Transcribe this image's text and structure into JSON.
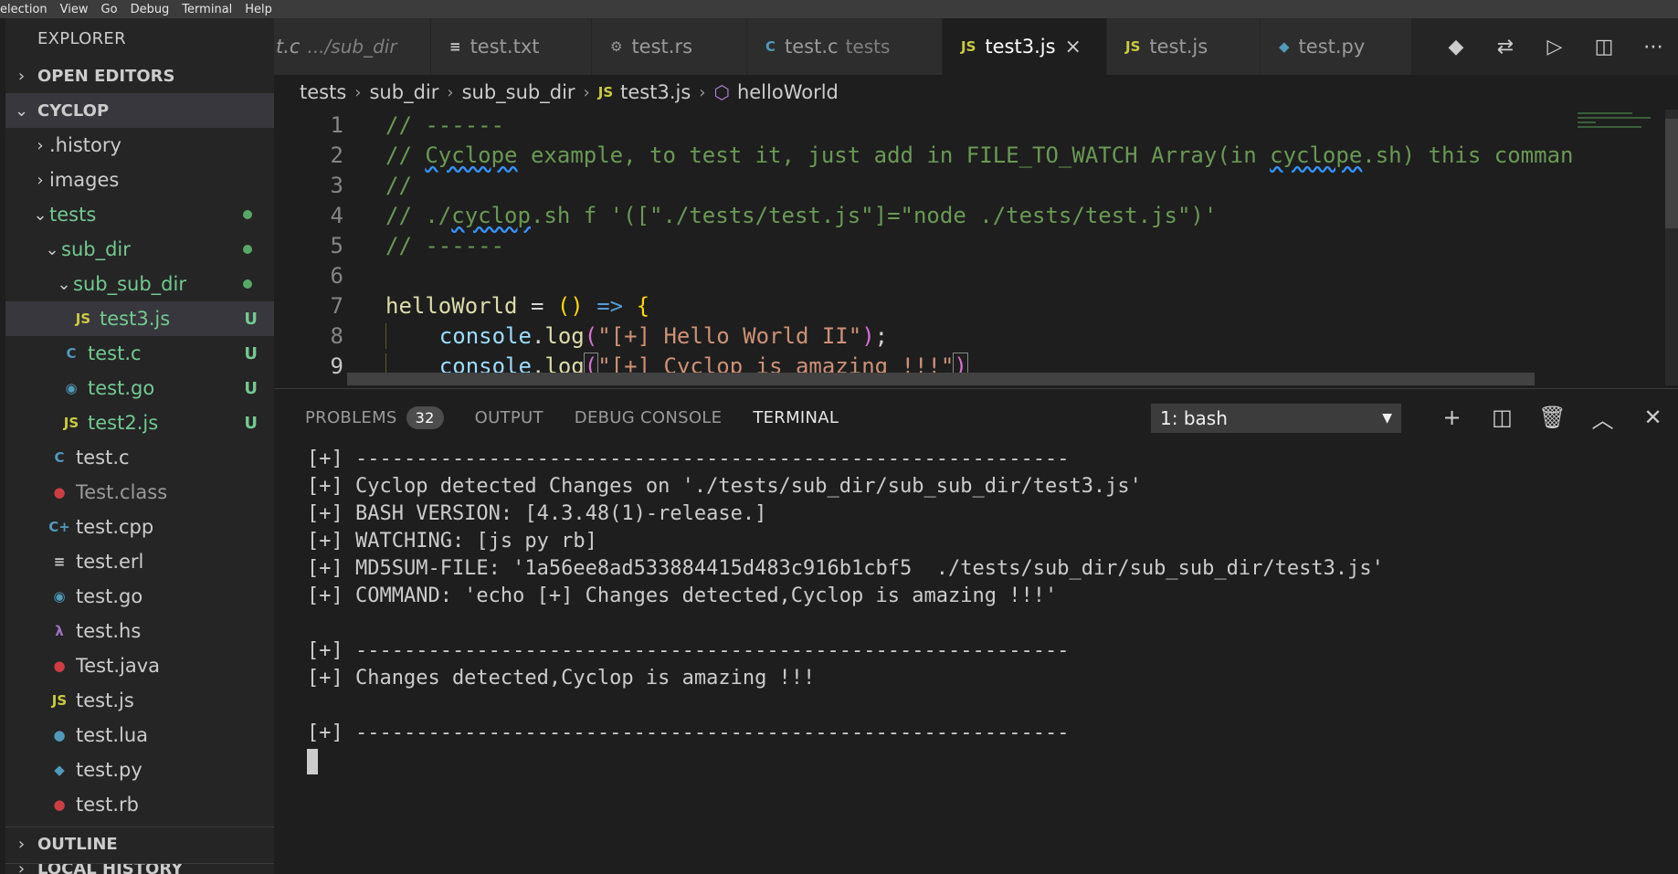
{
  "menu": [
    "election",
    "View",
    "Go",
    "Debug",
    "Terminal",
    "Help"
  ],
  "sidebar": {
    "title": "EXPLORER",
    "open_editors": "OPEN EDITORS",
    "root": "CYCLOP",
    "outline": "OUTLINE",
    "local_history": "LOCAL HISTORY",
    "items": [
      {
        "label": ".history",
        "indent": 0,
        "chev": "›",
        "icon": "",
        "icon_color": "",
        "status": "",
        "dot": false,
        "color": "#cccccc"
      },
      {
        "label": "images",
        "indent": 0,
        "chev": "›",
        "icon": "",
        "icon_color": "",
        "status": "",
        "dot": false,
        "color": "#cccccc"
      },
      {
        "label": "tests",
        "indent": 0,
        "chev": "⌄",
        "icon": "",
        "icon_color": "",
        "status": "",
        "dot": true,
        "color": "#73c991"
      },
      {
        "label": "sub_dir",
        "indent": 1,
        "chev": "⌄",
        "icon": "",
        "icon_color": "",
        "status": "",
        "dot": true,
        "color": "#73c991"
      },
      {
        "label": "sub_sub_dir",
        "indent": 2,
        "chev": "⌄",
        "icon": "",
        "icon_color": "",
        "status": "",
        "dot": true,
        "color": "#73c991"
      },
      {
        "label": "test3.js",
        "indent": 3,
        "chev": "",
        "icon": "JS",
        "icon_color": "#cbcb41",
        "status": "U",
        "dot": false,
        "color": "#73c991",
        "selected": true
      },
      {
        "label": "test.c",
        "indent": 2,
        "chev": "",
        "icon": "C",
        "icon_color": "#519aba",
        "status": "U",
        "dot": false,
        "color": "#73c991"
      },
      {
        "label": "test.go",
        "indent": 2,
        "chev": "",
        "icon": "◉",
        "icon_color": "#519aba",
        "status": "U",
        "dot": false,
        "color": "#73c991"
      },
      {
        "label": "test2.js",
        "indent": 2,
        "chev": "",
        "icon": "JS",
        "icon_color": "#cbcb41",
        "status": "U",
        "dot": false,
        "color": "#73c991"
      },
      {
        "label": "test.c",
        "indent": 1,
        "chev": "",
        "icon": "C",
        "icon_color": "#519aba",
        "status": "",
        "dot": false,
        "color": "#cccccc"
      },
      {
        "label": "Test.class",
        "indent": 1,
        "chev": "",
        "icon": "●",
        "icon_color": "#cc3e44",
        "status": "",
        "dot": false,
        "color": "#9a9a9a"
      },
      {
        "label": "test.cpp",
        "indent": 1,
        "chev": "",
        "icon": "C+",
        "icon_color": "#519aba",
        "status": "",
        "dot": false,
        "color": "#cccccc"
      },
      {
        "label": "test.erl",
        "indent": 1,
        "chev": "",
        "icon": "≡",
        "icon_color": "#cccccc",
        "status": "",
        "dot": false,
        "color": "#cccccc"
      },
      {
        "label": "test.go",
        "indent": 1,
        "chev": "",
        "icon": "◉",
        "icon_color": "#519aba",
        "status": "",
        "dot": false,
        "color": "#cccccc"
      },
      {
        "label": "test.hs",
        "indent": 1,
        "chev": "",
        "icon": "λ",
        "icon_color": "#a074c4",
        "status": "",
        "dot": false,
        "color": "#cccccc"
      },
      {
        "label": "Test.java",
        "indent": 1,
        "chev": "",
        "icon": "●",
        "icon_color": "#cc3e44",
        "status": "",
        "dot": false,
        "color": "#cccccc"
      },
      {
        "label": "test.js",
        "indent": 1,
        "chev": "",
        "icon": "JS",
        "icon_color": "#cbcb41",
        "status": "",
        "dot": false,
        "color": "#cccccc"
      },
      {
        "label": "test.lua",
        "indent": 1,
        "chev": "",
        "icon": "●",
        "icon_color": "#519aba",
        "status": "",
        "dot": false,
        "color": "#cccccc"
      },
      {
        "label": "test.py",
        "indent": 1,
        "chev": "",
        "icon": "◆",
        "icon_color": "#519aba",
        "status": "",
        "dot": false,
        "color": "#cccccc"
      },
      {
        "label": "test.rb",
        "indent": 1,
        "chev": "",
        "icon": "●",
        "icon_color": "#cc3e44",
        "status": "",
        "dot": false,
        "color": "#cccccc"
      }
    ]
  },
  "tabs": [
    {
      "label": "t.c",
      "desc": ".../sub_dir",
      "icon": "",
      "icon_color": "",
      "active": false,
      "width": 172
    },
    {
      "label": "test.txt",
      "desc": "",
      "icon": "≡",
      "icon_color": "#cccccc",
      "active": false,
      "width": 176
    },
    {
      "label": "test.rs",
      "desc": "",
      "icon": "⚙",
      "icon_color": "#9a9a9a",
      "active": false,
      "width": 170
    },
    {
      "label": "test.c",
      "desc": "tests",
      "icon": "C",
      "icon_color": "#519aba",
      "active": false,
      "width": 214
    },
    {
      "label": "test3.js",
      "desc": "",
      "icon": "JS",
      "icon_color": "#cbcb41",
      "active": true,
      "close": "×",
      "width": 180
    },
    {
      "label": "test.js",
      "desc": "",
      "icon": "JS",
      "icon_color": "#cbcb41",
      "active": false,
      "width": 168
    },
    {
      "label": "test.py",
      "desc": "",
      "icon": "◆",
      "icon_color": "#519aba",
      "active": false,
      "width": 166
    }
  ],
  "tab_actions": [
    "git-icon",
    "compare-icon",
    "run-icon",
    "split-icon",
    "more-icon"
  ],
  "breadcrumb": {
    "parts": [
      "tests",
      "sub_dir",
      "sub_sub_dir"
    ],
    "file_icon": "JS",
    "file": "test3.js",
    "symbol": "helloWorld"
  },
  "editor": {
    "line_numbers": [
      "1",
      "2",
      "3",
      "4",
      "5",
      "6",
      "7",
      "8",
      "9"
    ],
    "current_line": "9"
  },
  "panel": {
    "tabs": [
      {
        "label": "PROBLEMS",
        "badge": "32",
        "active": false
      },
      {
        "label": "OUTPUT",
        "badge": "",
        "active": false
      },
      {
        "label": "DEBUG CONSOLE",
        "badge": "",
        "active": false
      },
      {
        "label": "TERMINAL",
        "badge": "",
        "active": true
      }
    ],
    "terminal_select": "1: bash",
    "terminal_lines": [
      "[+] -----------------------------------------------------------",
      "[+] Cyclop detected Changes on './tests/sub_dir/sub_sub_dir/test3.js'",
      "[+] BASH VERSION: [4.3.48(1)-release.]",
      "[+] WATCHING: [js py rb]",
      "[+] MD5SUM-FILE: '1a56ee8ad533884415d483c916b1cbf5  ./tests/sub_dir/sub_sub_dir/test3.js'",
      "[+] COMMAND: 'echo [+] Changes detected,Cyclop is amazing !!!'",
      "",
      "[+] -----------------------------------------------------------",
      "[+] Changes detected,Cyclop is amazing !!!",
      "",
      "[+] -----------------------------------------------------------"
    ]
  },
  "colors": {
    "accent": "#73c991",
    "comment": "#6a9955",
    "string": "#ce9178",
    "function": "#dcdcaa",
    "keyword": "#569cd6"
  }
}
